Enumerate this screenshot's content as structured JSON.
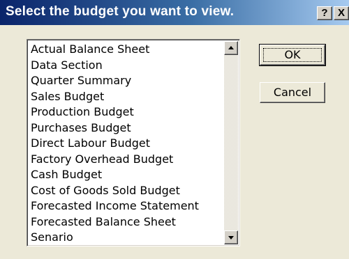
{
  "dialog": {
    "title": "Select the budget you want to view.",
    "help_label": "?",
    "close_label": "X"
  },
  "list": {
    "items": [
      "Actual Balance Sheet",
      "Data Section",
      "Quarter Summary",
      "Sales Budget",
      "Production Budget",
      "Purchases Budget",
      "Direct Labour Budget",
      "Factory Overhead Budget",
      "Cash Budget",
      "Cost of Goods Sold Budget",
      "Forecasted Income Statement",
      "Forecasted Balance Sheet",
      "Senario"
    ]
  },
  "buttons": {
    "ok_label": "OK",
    "cancel_label": "Cancel"
  },
  "colors": {
    "titlebar_start": "#0a246a",
    "titlebar_end": "#a6caf0",
    "dialog_bg": "#ece9d8"
  }
}
